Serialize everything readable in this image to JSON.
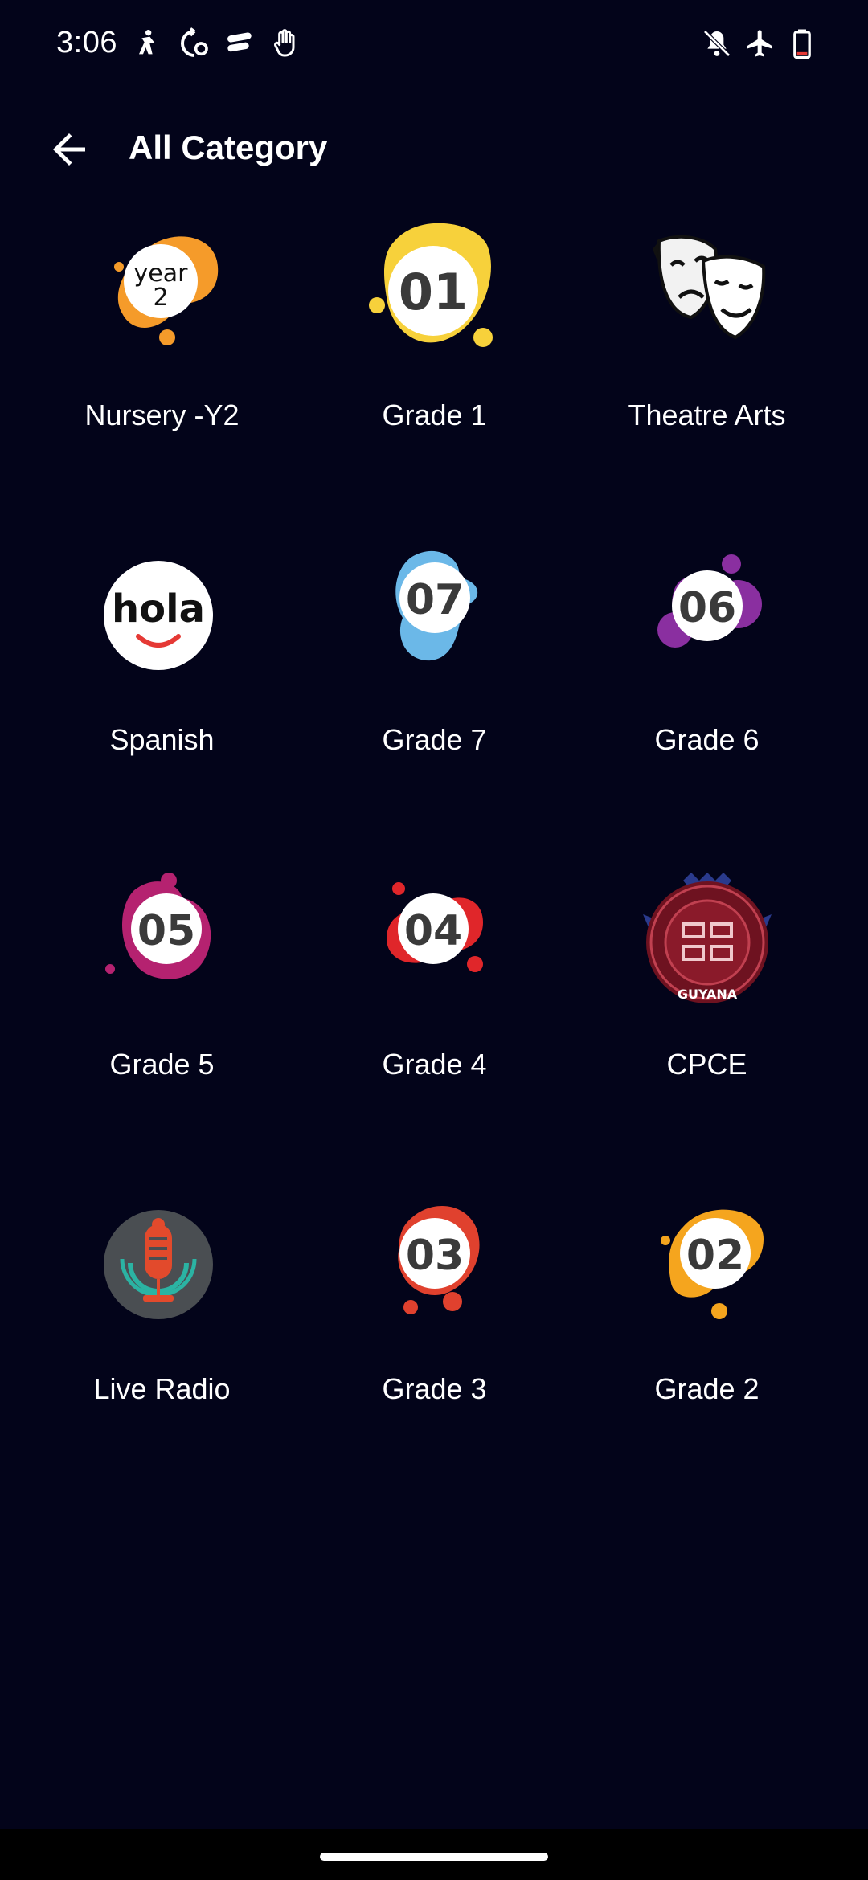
{
  "status_bar": {
    "time": "3:06"
  },
  "app_bar": {
    "title": "All Category"
  },
  "categories": [
    {
      "label": "Nursery -Y2",
      "icon": "year-2-icon",
      "badge_line1": "year",
      "badge_line2": "2",
      "color": "#F59B2A"
    },
    {
      "label": "Grade 1",
      "icon": "grade-01-icon",
      "badge": "01",
      "color": "#F7D13B"
    },
    {
      "label": "Theatre Arts",
      "icon": "theatre-masks-icon"
    },
    {
      "label": "Spanish",
      "icon": "hola-icon",
      "badge_text": "hola"
    },
    {
      "label": "Grade 7",
      "icon": "grade-07-icon",
      "badge": "07",
      "color": "#6BB8E8"
    },
    {
      "label": "Grade 6",
      "icon": "grade-06-icon",
      "badge": "06",
      "color": "#8A2FA0"
    },
    {
      "label": "Grade 5",
      "icon": "grade-05-icon",
      "badge": "05",
      "color": "#B52270"
    },
    {
      "label": "Grade 4",
      "icon": "grade-04-icon",
      "badge": "04",
      "color": "#E0262A"
    },
    {
      "label": "CPCE",
      "icon": "cpce-emblem-icon",
      "emblem_text": "GUYANA"
    },
    {
      "label": "Live Radio",
      "icon": "radio-microphone-icon"
    },
    {
      "label": "Grade 3",
      "icon": "grade-03-icon",
      "badge": "03",
      "color": "#E0412E"
    },
    {
      "label": "Grade 2",
      "icon": "grade-02-icon",
      "badge": "02",
      "color": "#F5A51E"
    }
  ]
}
